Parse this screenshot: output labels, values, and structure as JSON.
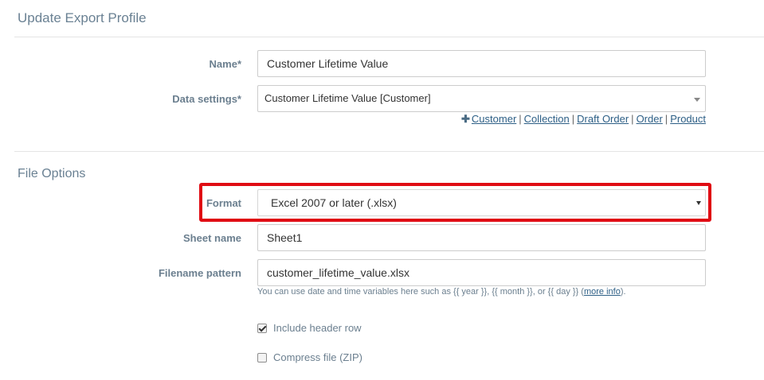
{
  "header": {
    "title": "Update Export Profile"
  },
  "form": {
    "name_label": "Name*",
    "name_value": "Customer Lifetime Value",
    "data_settings_label": "Data settings*",
    "data_settings_value": "Customer Lifetime Value [Customer]",
    "add_links": {
      "plus": "✚",
      "items": [
        "Customer",
        "Collection",
        "Draft Order",
        "Order",
        "Product"
      ],
      "separator": "|"
    }
  },
  "file_options": {
    "title": "File Options",
    "format_label": "Format",
    "format_value": "Excel 2007 or later (.xlsx)",
    "sheet_name_label": "Sheet name",
    "sheet_name_value": "Sheet1",
    "filename_pattern_label": "Filename pattern",
    "filename_pattern_value": "customer_lifetime_value.xlsx",
    "help_text_before": "You can use date and time variables here such as {{ year }}, {{ month }}, or {{ day }} (",
    "help_link": "more info",
    "help_text_after": ").",
    "include_header_label": "Include header row",
    "include_header_checked": true,
    "compress_label": "Compress file (ZIP)",
    "compress_checked": false
  },
  "colors": {
    "highlight": "#e00b13",
    "label": "#6b7f8f",
    "link": "#2d5f86"
  }
}
